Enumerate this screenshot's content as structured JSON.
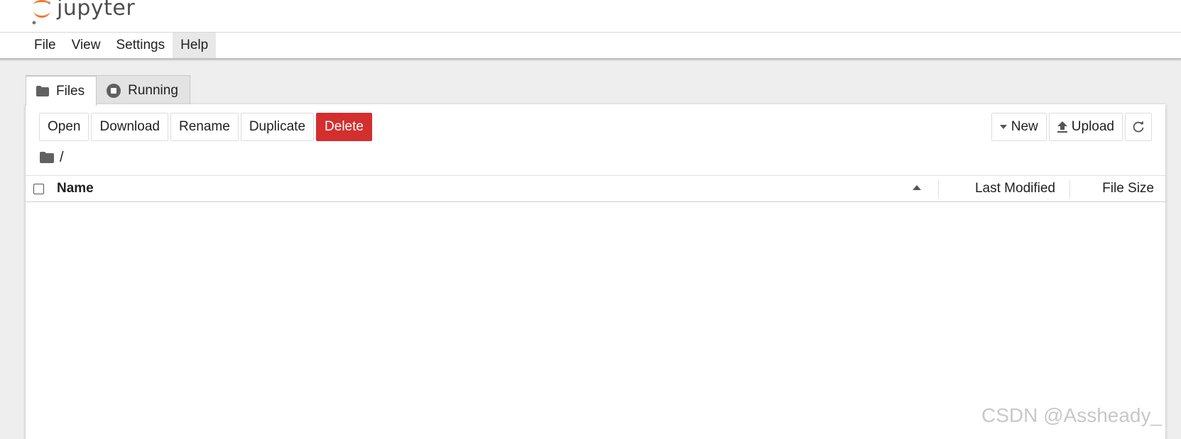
{
  "header": {
    "logo_text": "jupyter",
    "logo_color": "#F37726"
  },
  "menu": [
    {
      "label": "File"
    },
    {
      "label": "View"
    },
    {
      "label": "Settings"
    },
    {
      "label": "Help",
      "active": true
    }
  ],
  "tabs": [
    {
      "label": "Files",
      "icon": "folder-icon",
      "active": true
    },
    {
      "label": "Running",
      "icon": "stop-circle-icon",
      "active": false
    }
  ],
  "toolbar": {
    "open": "Open",
    "download": "Download",
    "rename": "Rename",
    "duplicate": "Duplicate",
    "delete": "Delete",
    "new": "New",
    "upload": "Upload",
    "danger_color": "#D32F2F"
  },
  "breadcrumb": {
    "path": "/"
  },
  "listing": {
    "columns": {
      "name": "Name",
      "last_modified": "Last Modified",
      "file_size": "File Size"
    },
    "sort": "name-ascending",
    "rows": []
  },
  "watermark": "CSDN @Assheady_"
}
